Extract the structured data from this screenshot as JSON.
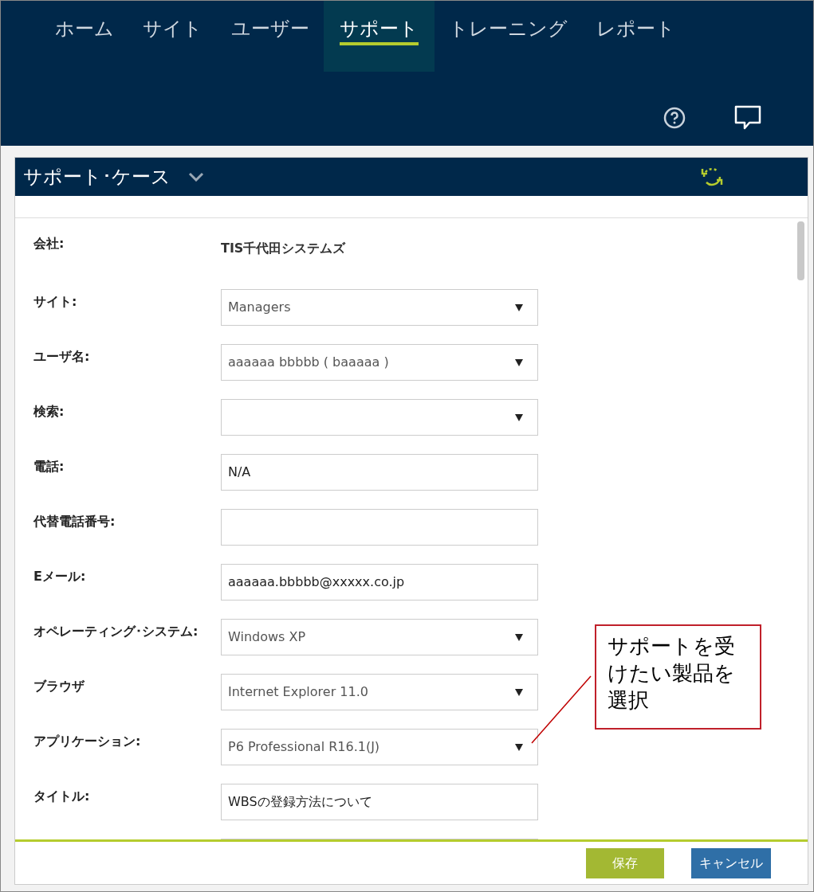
{
  "nav": {
    "tabs": [
      {
        "label": "ホーム",
        "selected": false
      },
      {
        "label": "サイト",
        "selected": false
      },
      {
        "label": "ユーザー",
        "selected": false
      },
      {
        "label": "サポート",
        "selected": true
      },
      {
        "label": "トレーニング",
        "selected": false
      },
      {
        "label": "レポート",
        "selected": false
      }
    ]
  },
  "panel": {
    "title": "サポート･ケース"
  },
  "form": {
    "fields": [
      {
        "label": "会社:",
        "kind": "static",
        "value": "TIS千代田システムズ"
      },
      {
        "label": "サイト:",
        "kind": "select",
        "value": "Managers"
      },
      {
        "label": "ユーザ名:",
        "kind": "select",
        "value": "aaaaaa bbbbb ( baaaaa )"
      },
      {
        "label": "検索:",
        "kind": "select"
      },
      {
        "label": "電話:",
        "kind": "text",
        "value": "N/A"
      },
      {
        "label": "代替電話番号:",
        "kind": "text"
      },
      {
        "label": "Eメール:",
        "kind": "text",
        "value": "aaaaaa.bbbbb@xxxxx.co.jp"
      },
      {
        "label": "オペレーティング･システム:",
        "kind": "select",
        "value": "Windows XP"
      },
      {
        "label": "ブラウザ",
        "kind": "select",
        "value": "Internet Explorer 11.0"
      },
      {
        "label": "アプリケーション:",
        "kind": "select",
        "value": "P6 Professional R16.1(J)"
      },
      {
        "label": "タイトル:",
        "kind": "text",
        "value": "WBSの登録方法について"
      }
    ]
  },
  "callout": {
    "text": "サポートを受けたい製品を選択"
  },
  "buttons": [
    {
      "label": "保存",
      "kind": "primary"
    },
    {
      "label": "キャンセル",
      "kind": "secondary"
    }
  ]
}
